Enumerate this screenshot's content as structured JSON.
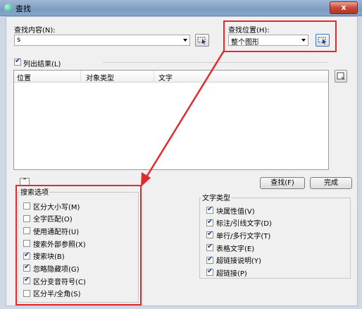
{
  "window": {
    "title": "查找",
    "close_glyph": "x"
  },
  "find_what": {
    "label": "查找内容(N):",
    "value": "s"
  },
  "find_where": {
    "label": "查找位置(H):",
    "selected": "整个图形"
  },
  "list_results": {
    "label": "列出结果(L)",
    "checked": true
  },
  "results_table": {
    "columns": [
      "位置",
      "对象类型",
      "文字"
    ]
  },
  "buttons": {
    "find": "查找(F)",
    "done": "完成"
  },
  "search_options": {
    "title": "搜索选项",
    "items": [
      {
        "label": "区分大小写(M)",
        "checked": false
      },
      {
        "label": "全字匹配(O)",
        "checked": false
      },
      {
        "label": "使用通配符(U)",
        "checked": false
      },
      {
        "label": "搜索外部参照(X)",
        "checked": false
      },
      {
        "label": "搜索块(B)",
        "checked": true
      },
      {
        "label": "忽略隐藏项(G)",
        "checked": true
      },
      {
        "label": "区分变音符号(C)",
        "checked": true
      },
      {
        "label": "区分半/全角(S)",
        "checked": false
      }
    ]
  },
  "text_types": {
    "title": "文字类型",
    "items": [
      {
        "label": "块属性值(V)",
        "checked": true
      },
      {
        "label": "标注/引线文字(D)",
        "checked": true
      },
      {
        "label": "单行/多行文字(T)",
        "checked": true
      },
      {
        "label": "表格文字(E)",
        "checked": true
      },
      {
        "label": "超链接说明(Y)",
        "checked": true
      },
      {
        "label": "超链接(P)",
        "checked": true
      }
    ]
  },
  "colors": {
    "annotation": "#e12b2b",
    "titlebar": "#8aa8cd"
  }
}
